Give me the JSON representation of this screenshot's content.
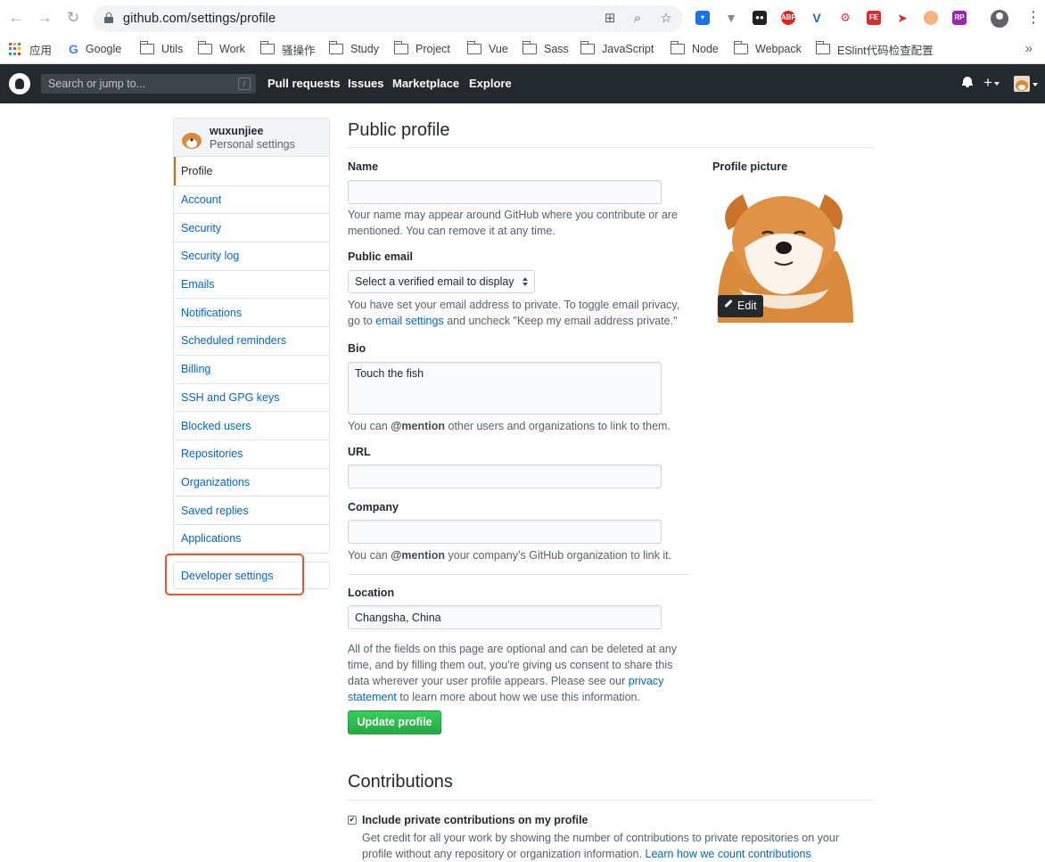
{
  "browser": {
    "url": "github.com/settings/profile",
    "bookmarks": [
      {
        "label": "应用",
        "icon": "apps-grid-icon"
      },
      {
        "label": "Google",
        "icon": "google-icon"
      },
      {
        "label": "Utils",
        "icon": "folder-icon"
      },
      {
        "label": "Work",
        "icon": "folder-icon"
      },
      {
        "label": "骚操作",
        "icon": "folder-icon"
      },
      {
        "label": "Study",
        "icon": "folder-icon"
      },
      {
        "label": "Project",
        "icon": "folder-icon"
      },
      {
        "label": "Vue",
        "icon": "folder-icon"
      },
      {
        "label": "Sass",
        "icon": "folder-icon"
      },
      {
        "label": "JavaScript",
        "icon": "folder-icon"
      },
      {
        "label": "Node",
        "icon": "folder-icon"
      },
      {
        "label": "Webpack",
        "icon": "folder-icon"
      },
      {
        "label": "ESlint代码检查配置",
        "icon": "folder-icon"
      }
    ],
    "bookmarks_more": "»",
    "extension_labels": [
      "ABP",
      "FE",
      "RP"
    ]
  },
  "gh_header": {
    "search_placeholder": "Search or jump to...",
    "search_key": "/",
    "nav": [
      "Pull requests",
      "Issues",
      "Marketplace",
      "Explore"
    ],
    "plus": "+"
  },
  "sidebar": {
    "username": "wuxunjiee",
    "subtitle": "Personal settings",
    "items": [
      "Profile",
      "Account",
      "Security",
      "Security log",
      "Emails",
      "Notifications",
      "Scheduled reminders",
      "Billing",
      "SSH and GPG keys",
      "Blocked users",
      "Repositories",
      "Organizations",
      "Saved replies",
      "Applications"
    ],
    "active_item": "Profile",
    "developer_settings": "Developer settings"
  },
  "profile": {
    "title": "Public profile",
    "name_label": "Name",
    "name_value": "",
    "name_note": "Your name may appear around GitHub where you contribute or are mentioned. You can remove it at any time.",
    "email_label": "Public email",
    "email_select": "Select a verified email to display",
    "email_note_1": "You have set your email address to private. To toggle email privacy, go to ",
    "email_note_link": "email settings",
    "email_note_2": " and uncheck \"Keep my email address private.\"",
    "bio_label": "Bio",
    "bio_value": "Touch the fish",
    "bio_note_1": "You can ",
    "bio_note_mention": "@mention",
    "bio_note_2": " other users and organizations to link to them.",
    "url_label": "URL",
    "url_value": "",
    "company_label": "Company",
    "company_value": "",
    "company_note_1": "You can ",
    "company_note_mention": "@mention",
    "company_note_2": " your company’s GitHub organization to link it.",
    "location_label": "Location",
    "location_value": "Changsha, China",
    "optional_note_1": "All of the fields on this page are optional and can be deleted at any time, and by filling them out, you're giving us consent to share this data wherever your user profile appears. Please see our ",
    "optional_note_link": "privacy statement",
    "optional_note_2": " to learn more about how we use this information.",
    "update_button": "Update profile",
    "picture_label": "Profile picture",
    "edit_button": "Edit"
  },
  "contributions": {
    "title": "Contributions",
    "checkbox_label": "Include private contributions on my profile",
    "checkbox_checked": true,
    "note_1": "Get credit for all your work by showing the number of contributions to private repositories on your profile without any repository or organization information. ",
    "note_link": "Learn how we count contributions"
  },
  "colors": {
    "header_bg": "#24292e",
    "link": "#0366d6",
    "button_green": "#28a745",
    "highlight_box": "#f0522a",
    "active_border": "#e36209"
  }
}
